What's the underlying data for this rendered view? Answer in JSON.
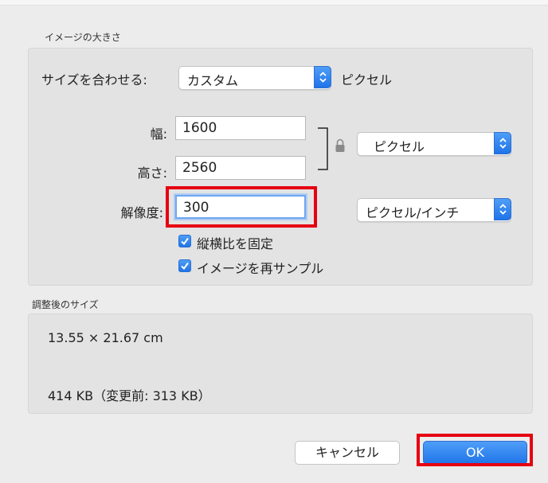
{
  "image_size": {
    "section_title": "イメージの大きさ",
    "fit_label": "サイズを合わせる:",
    "fit_value": "カスタム",
    "fit_unit": "ピクセル",
    "width_label": "幅:",
    "width_value": "1600",
    "height_label": "高さ:",
    "height_value": "2560",
    "dimension_unit": "ピクセル",
    "resolution_label": "解像度:",
    "resolution_value": "300",
    "resolution_unit": "ピクセル/インチ",
    "constrain_label": "縦横比を固定",
    "constrain_checked": true,
    "resample_label": "イメージを再サンプル",
    "resample_checked": true
  },
  "result": {
    "section_title": "調整後のサイズ",
    "dimensions": "13.55 × 21.67 cm",
    "file_size": "414 KB（変更前: 313 KB）"
  },
  "buttons": {
    "cancel_label": "キャンセル",
    "ok_label": "OK"
  },
  "colors": {
    "highlight_outline": "#e60012",
    "accent": "#1f74e8"
  }
}
